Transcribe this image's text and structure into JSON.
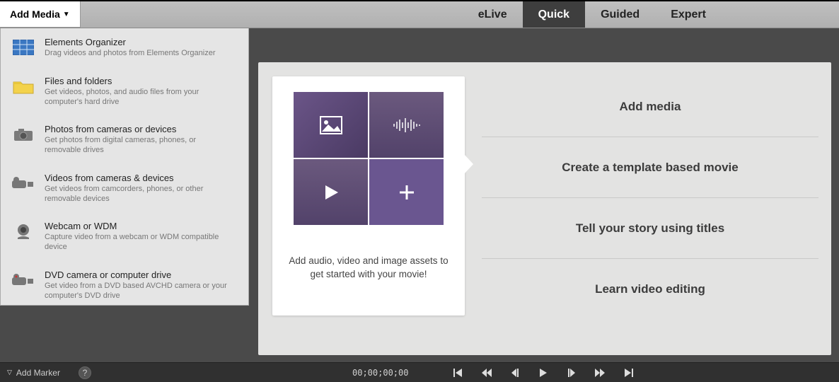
{
  "toolbar": {
    "add_media_label": "Add Media"
  },
  "tabs": [
    {
      "label": "eLive"
    },
    {
      "label": "Quick"
    },
    {
      "label": "Guided"
    },
    {
      "label": "Expert"
    }
  ],
  "active_tab_index": 1,
  "menu": [
    {
      "title": "Elements Organizer",
      "desc": "Drag videos and photos from Elements Organizer",
      "icon": "organizer"
    },
    {
      "title": "Files and folders",
      "desc": "Get videos, photos, and audio files from your computer's hard drive",
      "icon": "folder"
    },
    {
      "title": "Photos from cameras or devices",
      "desc": "Get photos from digital cameras, phones, or removable drives",
      "icon": "camera"
    },
    {
      "title": "Videos from cameras & devices",
      "desc": "Get videos from camcorders, phones, or other removable devices",
      "icon": "camcorder"
    },
    {
      "title": "Webcam or WDM",
      "desc": "Capture video from a webcam or WDM compatible device",
      "icon": "webcam"
    },
    {
      "title": "DVD camera or computer drive",
      "desc": "Get video from a DVD based AVCHD camera or your computer's DVD drive",
      "icon": "dvdcam"
    }
  ],
  "card": {
    "caption": "Add audio, video and image assets to get started with your movie!"
  },
  "options": [
    "Add media",
    "Create a template based movie",
    "Tell your story using titles",
    "Learn video editing"
  ],
  "footer": {
    "marker_label": "Add Marker",
    "timecode": "00;00;00;00"
  }
}
